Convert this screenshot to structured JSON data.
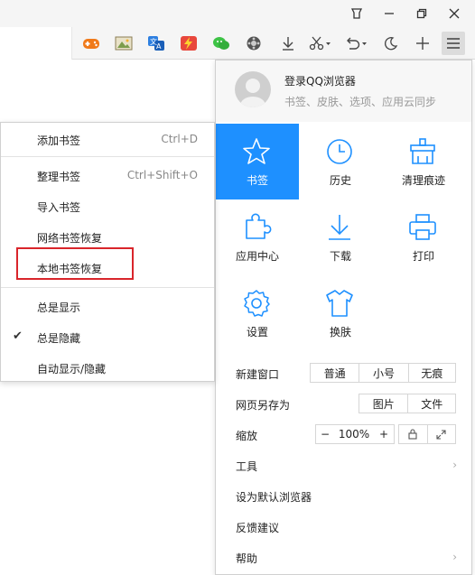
{
  "window": {
    "controls": {
      "skin_icon": "skin-icon",
      "minimize": "minimize-icon",
      "maximize": "maximize-icon",
      "close": "close-icon"
    }
  },
  "toolbar": {
    "icons": [
      "search-icon",
      "game-icon",
      "image-icon",
      "translate-icon",
      "flash-icon",
      "wechat-icon",
      "film-icon",
      "download-icon",
      "scissors-icon",
      "undo-icon",
      "night-mode-icon",
      "new-tab-icon",
      "menu-icon"
    ]
  },
  "account": {
    "title": "登录QQ浏览器",
    "subtitle": "书签、皮肤、选项、应用云同步"
  },
  "grid": [
    {
      "label": "书签",
      "icon": "star-icon",
      "active": true
    },
    {
      "label": "历史",
      "icon": "clock-icon",
      "active": false
    },
    {
      "label": "清理痕迹",
      "icon": "broom-icon",
      "active": false
    },
    {
      "label": "应用中心",
      "icon": "puzzle-icon",
      "active": false
    },
    {
      "label": "下载",
      "icon": "download-icon",
      "active": false
    },
    {
      "label": "打印",
      "icon": "printer-icon",
      "active": false
    },
    {
      "label": "设置",
      "icon": "gear-icon",
      "active": false
    },
    {
      "label": "换肤",
      "icon": "shirt-icon",
      "active": false
    }
  ],
  "rows": {
    "new_window": {
      "label": "新建窗口",
      "options": [
        "普通",
        "小号",
        "无痕"
      ]
    },
    "save_as": {
      "label": "网页另存为",
      "options": [
        "图片",
        "文件"
      ]
    },
    "zoom": {
      "label": "缩放",
      "minus": "−",
      "value": "100%",
      "plus": "+"
    },
    "tools": {
      "label": "工具"
    },
    "default_browser": {
      "label": "设为默认浏览器"
    },
    "feedback": {
      "label": "反馈建议"
    },
    "help": {
      "label": "帮助"
    }
  },
  "submenu": {
    "add_bookmark": {
      "label": "添加书签",
      "shortcut": "Ctrl+D"
    },
    "organize": {
      "label": "整理书签",
      "shortcut": "Ctrl+Shift+O"
    },
    "import": {
      "label": "导入书签"
    },
    "net_restore": {
      "label": "网络书签恢复"
    },
    "local_restore": {
      "label": "本地书签恢复"
    },
    "always_show": {
      "label": "总是显示"
    },
    "always_hide": {
      "label": "总是隐藏",
      "checked": true
    },
    "auto_hide": {
      "label": "自动显示/隐藏"
    }
  },
  "colors": {
    "accent": "#1e90ff",
    "highlight": "#d9252b"
  }
}
